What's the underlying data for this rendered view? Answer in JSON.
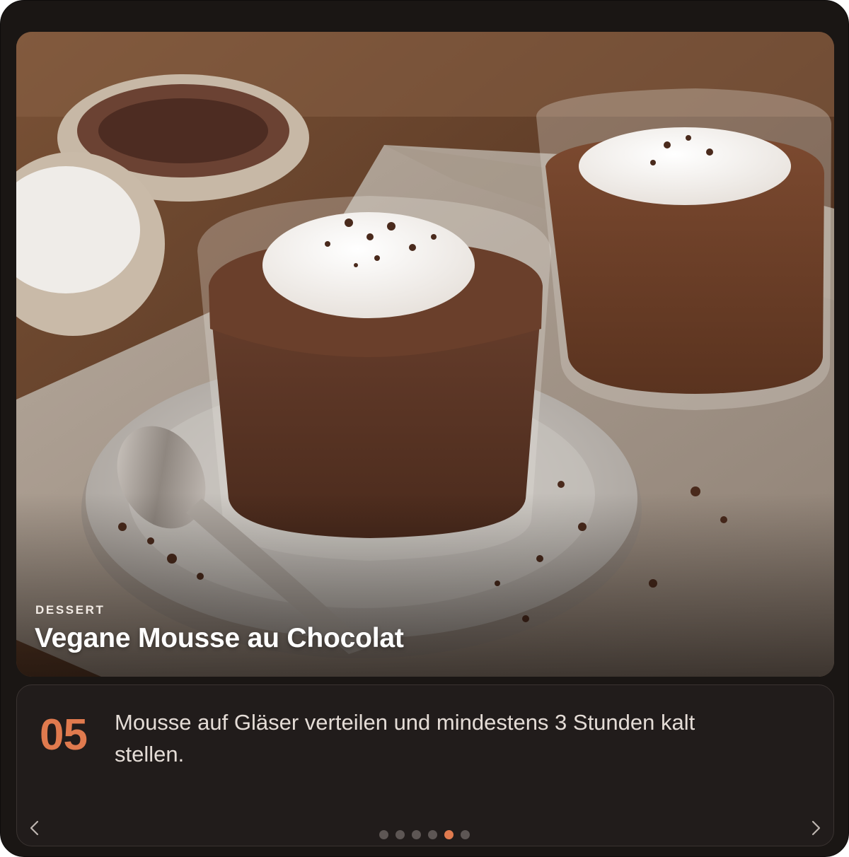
{
  "recipe": {
    "category": "DESSERT",
    "title": "Vegane Mousse au Chocolat"
  },
  "step": {
    "number": "05",
    "text": "Mousse auf Gläser verteilen und mindestens 3 Stunden kalt stellen.",
    "current_index": 4,
    "total": 6
  },
  "navigation": {
    "prev_icon": "chevron-left-icon",
    "next_icon": "chevron-right-icon"
  },
  "colors": {
    "accent": "#e07a4e",
    "background": "#1a1614",
    "card": "#211c1b",
    "dot_inactive": "#5d5654"
  }
}
